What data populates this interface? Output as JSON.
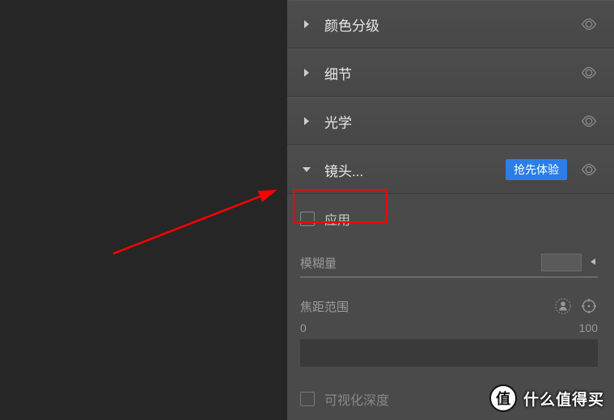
{
  "panels": {
    "color_grading": {
      "label": "颜色分级"
    },
    "detail": {
      "label": "细节"
    },
    "optics": {
      "label": "光学"
    },
    "lens": {
      "label": "镜头...",
      "badge": "抢先体验",
      "apply_label": "应用",
      "blur": {
        "label": "模糊量"
      },
      "focus_range": {
        "label": "焦距范围",
        "min": "0",
        "max": "100"
      },
      "visualize_depth": {
        "label": "可视化深度"
      }
    }
  },
  "watermark": {
    "circle": "值",
    "text": "什么值得买"
  }
}
